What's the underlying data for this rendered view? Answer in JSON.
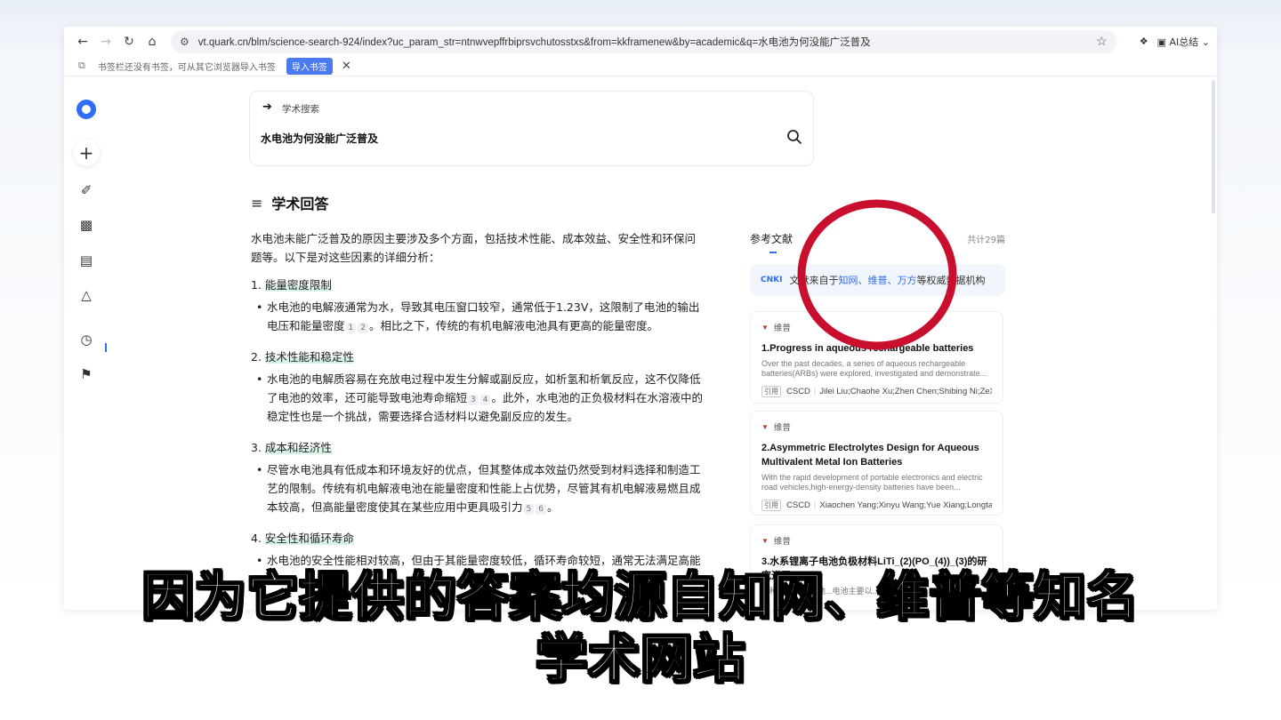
{
  "browser": {
    "url": "vt.quark.cn/blm/science-search-924/index?uc_param_str=ntnwvepffrbiprsvchutosstxs&from=kkframenew&by=academic&q=水电池为何没能广泛普及",
    "ai_summary_label": "AI总结",
    "bookmark_bar_text": "书签栏还没有书签，可从其它浏览器导入书签",
    "import_button": "导入书签"
  },
  "search": {
    "crumb": "学术搜索",
    "query": "水电池为何没能广泛普及"
  },
  "answer": {
    "title": "学术回答",
    "intro": "水电池未能广泛普及的原因主要涉及多个方面，包括技术性能、成本效益、安全性和环保问题等。以下是对这些因素的详细分析：",
    "sections": [
      {
        "num": "1.",
        "head": "能量密度限制",
        "text_a": "水电池的电解液通常为水，导致其电压窗口较窄，通常低于1.23V，这限制了电池的输出电压和能量密度",
        "cites": [
          "1",
          "2"
        ],
        "text_b": "。相比之下，传统的有机电解液电池具有更高的能量密度。"
      },
      {
        "num": "2.",
        "head": "技术性能和稳定性",
        "text_a": "水电池的电解质容易在充放电过程中发生分解或副反应，如析氢和析氧反应，这不仅降低了电池的效率，还可能导致电池寿命缩短",
        "cites": [
          "3",
          "4"
        ],
        "text_b": "。此外，水电池的正负极材料在水溶液中的稳定性也是一个挑战，需要选择合适材料以避免副反应的发生。"
      },
      {
        "num": "3.",
        "head": "成本和经济性",
        "text_a": "尽管水电池具有低成本和环境友好的优点，但其整体成本效益仍然受到材料选择和制造工艺的限制。传统有机电解液电池在能量密度和性能上占优势，尽管其有机电解液易燃且成本较高，但高能量密度使其在某些应用中更具吸引力",
        "cites": [
          "5",
          "6"
        ],
        "text_b": "。"
      },
      {
        "num": "4.",
        "head": "安全性和循环寿命",
        "text_a": "水电池的安全性能相对较高，但由于其能量密度较低，循环寿命较短，通常无法满足高能",
        "cites": [],
        "text_b": ""
      }
    ]
  },
  "refs": {
    "title": "参考文献",
    "count": "共计29篇",
    "source_prefix": "文献来自于",
    "source_links": "知网、维普、万方",
    "source_suffix": "等权威数据机构",
    "source_logos": "CNKI",
    "cards": [
      {
        "source": "维普",
        "title": "1.Progress in aqueous rechargeable batteries",
        "abstract": "Over the past decades, a series of aqueous rechargeable batteries(ARBs) were explored, investigated and demonstrate...",
        "tag": "引用",
        "journal": "CSCD",
        "authors": "Jilei Liu;Chaohe Xu;Zhen Chen;Shibing Ni;ZeX..."
      },
      {
        "source": "维普",
        "title": "2.Asymmetric Electrolytes Design for Aqueous Multivalent Metal Ion Batteries",
        "abstract": "With the rapid development of portable electronics and electric road vehicles,high-energy-density batteries have been...",
        "tag": "引用",
        "journal": "CSCD",
        "authors": "Xiaochen Yang;Xinyu Wang;Yue Xiang;Longta..."
      },
      {
        "source": "维普",
        "title": "3.水系锂离子电池负极材料LiTi_(2)(PO_(4))_(3)的研究进展",
        "abstract": "一种绿色可充电池...电池主要以...",
        "tag": "",
        "journal": "",
        "authors": ""
      }
    ]
  },
  "subtitle": {
    "line1": "因为它提供的答案均源自知网、维普等知名",
    "line2": "学术网站"
  },
  "colors": {
    "accent": "#2f6df6",
    "highlight": "#d6f3e6",
    "annotation_circle": "#c8102e"
  }
}
